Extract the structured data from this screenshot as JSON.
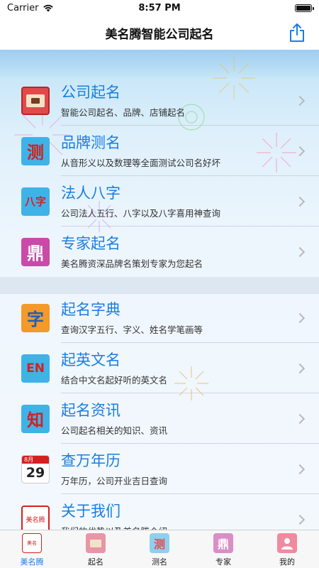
{
  "status": {
    "carrier": "Carrier",
    "time": "8:57 PM"
  },
  "nav": {
    "title": "美名腾智能公司起名"
  },
  "section1": [
    {
      "title": "公司起名",
      "subtitle": "智能公司起名、品牌、店铺起名",
      "icon": "company-seal-icon"
    },
    {
      "title": "品牌测名",
      "subtitle": "从音形义以及数理等全面测试公司名好坏",
      "icon": "test-icon",
      "glyph": "测"
    },
    {
      "title": "法人八字",
      "subtitle": "公司法人五行、八字以及八字喜用神查询",
      "icon": "bazi-icon",
      "glyph": "八字"
    },
    {
      "title": "专家起名",
      "subtitle": "美名腾资深品牌名策划专家为您起名",
      "icon": "expert-icon",
      "glyph": "鼎"
    }
  ],
  "section2": [
    {
      "title": "起名字典",
      "subtitle": "查询汉字五行、字义、姓名学笔画等",
      "icon": "dictionary-icon",
      "glyph": "字"
    },
    {
      "title": "起英文名",
      "subtitle": "结合中文名起好听的英文名",
      "icon": "english-icon",
      "glyph": "EN"
    },
    {
      "title": "起名资讯",
      "subtitle": "公司起名相关的知识、资讯",
      "icon": "knowledge-icon",
      "glyph": "知"
    },
    {
      "title": "查万年历",
      "subtitle": "万年历，公司开业吉日查询",
      "icon": "calendar-icon",
      "glyph": "29",
      "month": "8月"
    },
    {
      "title": "关于我们",
      "subtitle": "我们的优势以及美名腾介绍",
      "icon": "about-logo-icon",
      "glyph": "美名腾"
    }
  ],
  "tabs": [
    {
      "label": "美名腾",
      "icon": "home-logo-icon",
      "active": true
    },
    {
      "label": "起名",
      "icon": "naming-icon",
      "active": false
    },
    {
      "label": "测名",
      "icon": "test-tab-icon",
      "active": false
    },
    {
      "label": "专家",
      "icon": "expert-tab-icon",
      "active": false
    },
    {
      "label": "我的",
      "icon": "profile-icon",
      "active": false
    }
  ],
  "colors": {
    "accent": "#1a7ee0",
    "tab_bg": "#f7f7f7",
    "section_gap": "#dde7f2"
  }
}
